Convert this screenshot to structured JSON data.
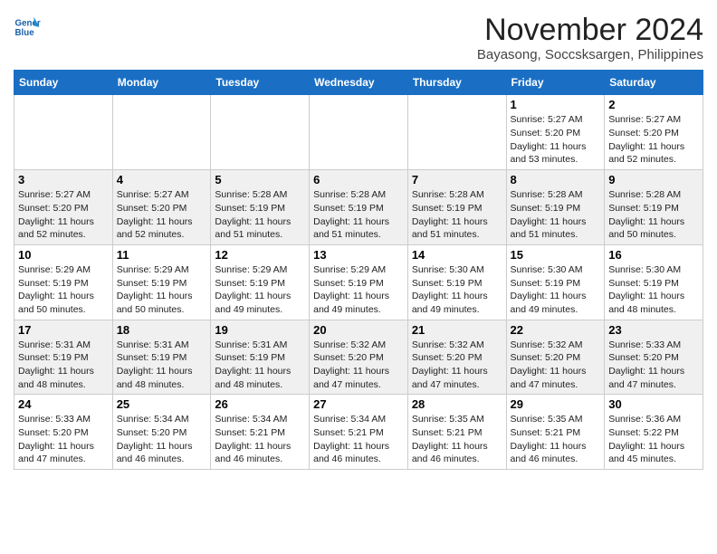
{
  "header": {
    "logo_line1": "General",
    "logo_line2": "Blue",
    "month_title": "November 2024",
    "location": "Bayasong, Soccsksargen, Philippines"
  },
  "days_of_week": [
    "Sunday",
    "Monday",
    "Tuesday",
    "Wednesday",
    "Thursday",
    "Friday",
    "Saturday"
  ],
  "weeks": [
    [
      {
        "day": "",
        "info": ""
      },
      {
        "day": "",
        "info": ""
      },
      {
        "day": "",
        "info": ""
      },
      {
        "day": "",
        "info": ""
      },
      {
        "day": "",
        "info": ""
      },
      {
        "day": "1",
        "info": "Sunrise: 5:27 AM\nSunset: 5:20 PM\nDaylight: 11 hours and 53 minutes."
      },
      {
        "day": "2",
        "info": "Sunrise: 5:27 AM\nSunset: 5:20 PM\nDaylight: 11 hours and 52 minutes."
      }
    ],
    [
      {
        "day": "3",
        "info": "Sunrise: 5:27 AM\nSunset: 5:20 PM\nDaylight: 11 hours and 52 minutes."
      },
      {
        "day": "4",
        "info": "Sunrise: 5:27 AM\nSunset: 5:20 PM\nDaylight: 11 hours and 52 minutes."
      },
      {
        "day": "5",
        "info": "Sunrise: 5:28 AM\nSunset: 5:19 PM\nDaylight: 11 hours and 51 minutes."
      },
      {
        "day": "6",
        "info": "Sunrise: 5:28 AM\nSunset: 5:19 PM\nDaylight: 11 hours and 51 minutes."
      },
      {
        "day": "7",
        "info": "Sunrise: 5:28 AM\nSunset: 5:19 PM\nDaylight: 11 hours and 51 minutes."
      },
      {
        "day": "8",
        "info": "Sunrise: 5:28 AM\nSunset: 5:19 PM\nDaylight: 11 hours and 51 minutes."
      },
      {
        "day": "9",
        "info": "Sunrise: 5:28 AM\nSunset: 5:19 PM\nDaylight: 11 hours and 50 minutes."
      }
    ],
    [
      {
        "day": "10",
        "info": "Sunrise: 5:29 AM\nSunset: 5:19 PM\nDaylight: 11 hours and 50 minutes."
      },
      {
        "day": "11",
        "info": "Sunrise: 5:29 AM\nSunset: 5:19 PM\nDaylight: 11 hours and 50 minutes."
      },
      {
        "day": "12",
        "info": "Sunrise: 5:29 AM\nSunset: 5:19 PM\nDaylight: 11 hours and 49 minutes."
      },
      {
        "day": "13",
        "info": "Sunrise: 5:29 AM\nSunset: 5:19 PM\nDaylight: 11 hours and 49 minutes."
      },
      {
        "day": "14",
        "info": "Sunrise: 5:30 AM\nSunset: 5:19 PM\nDaylight: 11 hours and 49 minutes."
      },
      {
        "day": "15",
        "info": "Sunrise: 5:30 AM\nSunset: 5:19 PM\nDaylight: 11 hours and 49 minutes."
      },
      {
        "day": "16",
        "info": "Sunrise: 5:30 AM\nSunset: 5:19 PM\nDaylight: 11 hours and 48 minutes."
      }
    ],
    [
      {
        "day": "17",
        "info": "Sunrise: 5:31 AM\nSunset: 5:19 PM\nDaylight: 11 hours and 48 minutes."
      },
      {
        "day": "18",
        "info": "Sunrise: 5:31 AM\nSunset: 5:19 PM\nDaylight: 11 hours and 48 minutes."
      },
      {
        "day": "19",
        "info": "Sunrise: 5:31 AM\nSunset: 5:19 PM\nDaylight: 11 hours and 48 minutes."
      },
      {
        "day": "20",
        "info": "Sunrise: 5:32 AM\nSunset: 5:20 PM\nDaylight: 11 hours and 47 minutes."
      },
      {
        "day": "21",
        "info": "Sunrise: 5:32 AM\nSunset: 5:20 PM\nDaylight: 11 hours and 47 minutes."
      },
      {
        "day": "22",
        "info": "Sunrise: 5:32 AM\nSunset: 5:20 PM\nDaylight: 11 hours and 47 minutes."
      },
      {
        "day": "23",
        "info": "Sunrise: 5:33 AM\nSunset: 5:20 PM\nDaylight: 11 hours and 47 minutes."
      }
    ],
    [
      {
        "day": "24",
        "info": "Sunrise: 5:33 AM\nSunset: 5:20 PM\nDaylight: 11 hours and 47 minutes."
      },
      {
        "day": "25",
        "info": "Sunrise: 5:34 AM\nSunset: 5:20 PM\nDaylight: 11 hours and 46 minutes."
      },
      {
        "day": "26",
        "info": "Sunrise: 5:34 AM\nSunset: 5:21 PM\nDaylight: 11 hours and 46 minutes."
      },
      {
        "day": "27",
        "info": "Sunrise: 5:34 AM\nSunset: 5:21 PM\nDaylight: 11 hours and 46 minutes."
      },
      {
        "day": "28",
        "info": "Sunrise: 5:35 AM\nSunset: 5:21 PM\nDaylight: 11 hours and 46 minutes."
      },
      {
        "day": "29",
        "info": "Sunrise: 5:35 AM\nSunset: 5:21 PM\nDaylight: 11 hours and 46 minutes."
      },
      {
        "day": "30",
        "info": "Sunrise: 5:36 AM\nSunset: 5:22 PM\nDaylight: 11 hours and 45 minutes."
      }
    ]
  ]
}
